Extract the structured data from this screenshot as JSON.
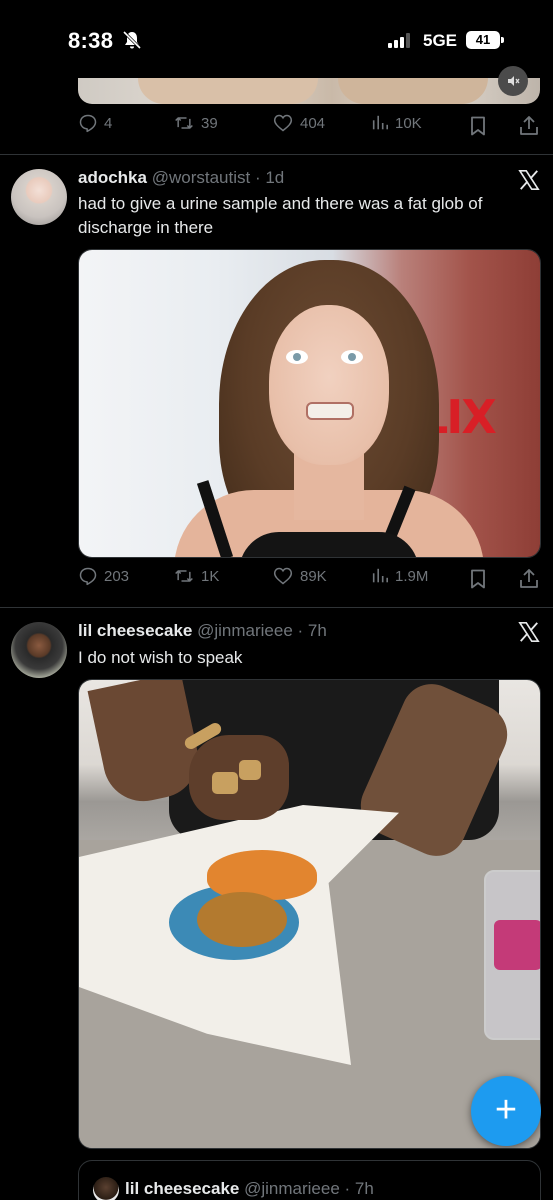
{
  "status_bar": {
    "time": "8:38",
    "network": "5GE",
    "battery": "41"
  },
  "previous_tweet": {
    "stats": {
      "replies": "4",
      "retweets": "39",
      "likes": "404",
      "views": "10K"
    }
  },
  "tweets": [
    {
      "name": "adochka",
      "handle": "@worstautist",
      "time": "1d",
      "text": "had to give a urine sample and there was a fat glob of discharge in there",
      "media_text": "LIX",
      "stats": {
        "replies": "203",
        "retweets": "1K",
        "likes": "89K",
        "views": "1.9M"
      }
    },
    {
      "name": "lil cheesecake",
      "handle": "@jinmarieee",
      "time": "7h",
      "text": "I do not wish to speak"
    }
  ],
  "quoted": {
    "name": "lil cheesecake",
    "handle": "@jinmarieee",
    "time": "7h"
  },
  "fab": {
    "label": "+"
  },
  "colors": {
    "accent": "#1d9bf0",
    "muted": "#71767b",
    "divider": "#2f3336"
  }
}
